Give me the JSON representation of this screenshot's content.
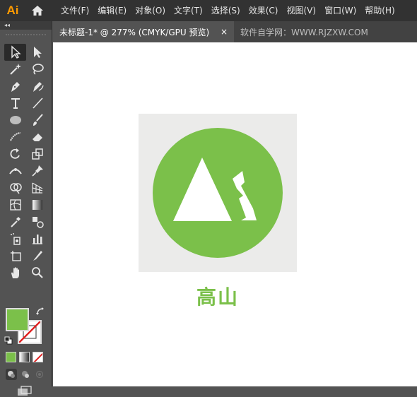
{
  "app": {
    "logo": "Ai"
  },
  "menu": [
    "文件(F)",
    "编辑(E)",
    "对象(O)",
    "文字(T)",
    "选择(S)",
    "效果(C)",
    "视图(V)",
    "窗口(W)",
    "帮助(H)"
  ],
  "toolbar": {
    "collapse_label": "◂◂",
    "fill_color": "#7bc04a",
    "stroke_color": "#ffffff"
  },
  "tabs": [
    {
      "label": "未标题-1* @ 277% (CMYK/GPU 预览)",
      "active": true,
      "close": "×"
    },
    {
      "label": "软件自学网：WWW.RJZXW.COM",
      "active": false
    }
  ],
  "artwork": {
    "background_color": "#ebebea",
    "circle_color": "#7bc04a",
    "mountain_color": "#ffffff",
    "caption": "高山"
  }
}
